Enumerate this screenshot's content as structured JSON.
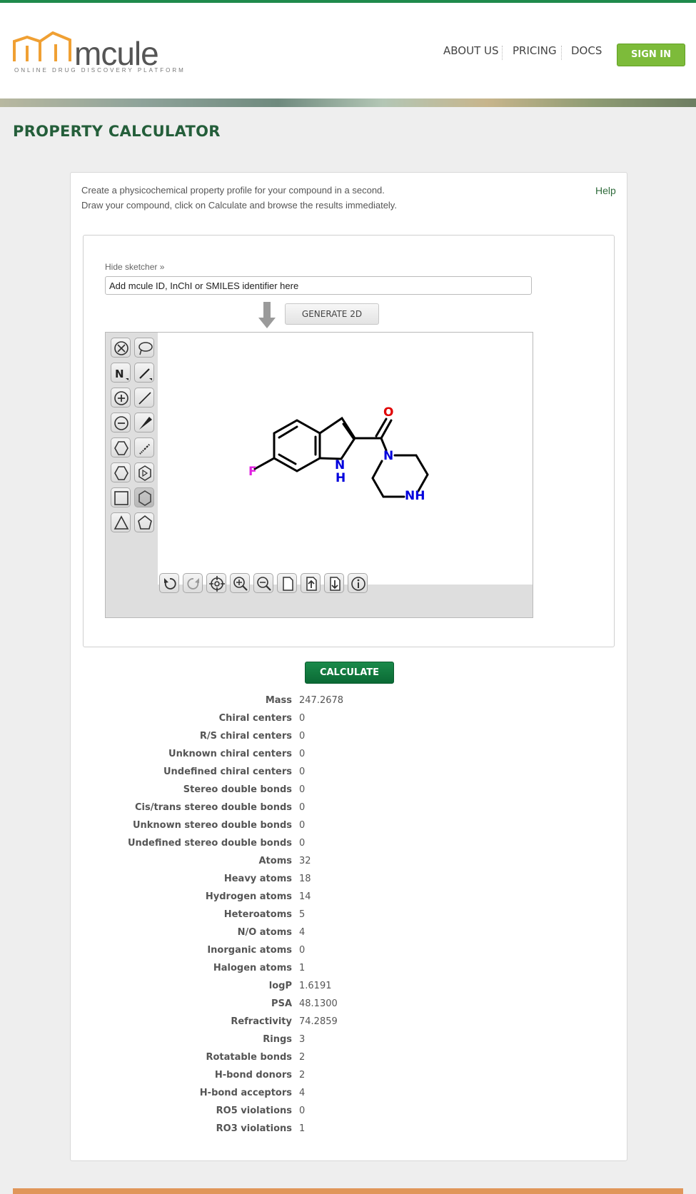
{
  "header": {
    "logo_text": "mcule",
    "logo_tagline": "ONLINE DRUG DISCOVERY PLATFORM",
    "nav": [
      "ABOUT US",
      "PRICING",
      "DOCS"
    ],
    "signin_label": "SIGN IN"
  },
  "page": {
    "title": "PROPERTY CALCULATOR",
    "intro_line1": "Create a physicochemical property profile for your compound in a second.",
    "intro_line2": "Draw your compound, click on Calculate and browse the results immediately.",
    "help_label": "Help"
  },
  "sketcher": {
    "hide_label": "Hide sketcher »",
    "input_value": "Add mcule ID, InChI or SMILES identifier here",
    "generate_label": "GENERATE 2D",
    "atom_labels": {
      "fluorine": "F",
      "indole_n": "N",
      "indole_h": "H",
      "oxygen": "O",
      "amide_n": "N",
      "piperazine_nh": "NH"
    },
    "left_tools": [
      "delete-icon",
      "lasso-icon",
      "atom-icon",
      "single-bond-icon",
      "charge-plus-icon",
      "line-bond-icon",
      "charge-minus-icon",
      "wedge-bond-icon",
      "cyclohexane-icon",
      "hash-bond-icon",
      "cyclohexane-ring-icon",
      "benzene-icon",
      "cyclobutane-icon",
      "hexagon-icon",
      "cyclopropane-icon",
      "cyclopentane-icon"
    ],
    "bottom_tools": [
      "undo-icon",
      "redo-icon",
      "center-icon",
      "zoom-in-icon",
      "zoom-out-icon",
      "new-document-icon",
      "import-icon",
      "export-icon",
      "info-icon"
    ]
  },
  "calculate_label": "CALCULATE",
  "properties": [
    {
      "label": "Mass",
      "value": "247.2678"
    },
    {
      "label": "Chiral centers",
      "value": "0"
    },
    {
      "label": "R/S chiral centers",
      "value": "0"
    },
    {
      "label": "Unknown chiral centers",
      "value": "0"
    },
    {
      "label": "Undefined chiral centers",
      "value": "0"
    },
    {
      "label": "Stereo double bonds",
      "value": "0"
    },
    {
      "label": "Cis/trans stereo double bonds",
      "value": "0"
    },
    {
      "label": "Unknown stereo double bonds",
      "value": "0"
    },
    {
      "label": "Undefined stereo double bonds",
      "value": "0"
    },
    {
      "label": "Atoms",
      "value": "32"
    },
    {
      "label": "Heavy atoms",
      "value": "18"
    },
    {
      "label": "Hydrogen atoms",
      "value": "14"
    },
    {
      "label": "Heteroatoms",
      "value": "5"
    },
    {
      "label": "N/O atoms",
      "value": "4"
    },
    {
      "label": "Inorganic atoms",
      "value": "0"
    },
    {
      "label": "Halogen atoms",
      "value": "1"
    },
    {
      "label": "logP",
      "value": "1.6191"
    },
    {
      "label": "PSA",
      "value": "48.1300"
    },
    {
      "label": "Refractivity",
      "value": "74.2859"
    },
    {
      "label": "Rings",
      "value": "3"
    },
    {
      "label": "Rotatable bonds",
      "value": "2"
    },
    {
      "label": "H-bond donors",
      "value": "2"
    },
    {
      "label": "H-bond acceptors",
      "value": "4"
    },
    {
      "label": "RO5 violations",
      "value": "0"
    },
    {
      "label": "RO3 violations",
      "value": "1"
    }
  ],
  "colors": {
    "brand_green": "#245e3a",
    "signin_green": "#7dbb3a",
    "calc_green": "#0b6a35",
    "logo_orange": "#f0a033",
    "fluorine": "#e020e0",
    "oxygen": "#e00000",
    "nitrogen": "#0000dd"
  }
}
